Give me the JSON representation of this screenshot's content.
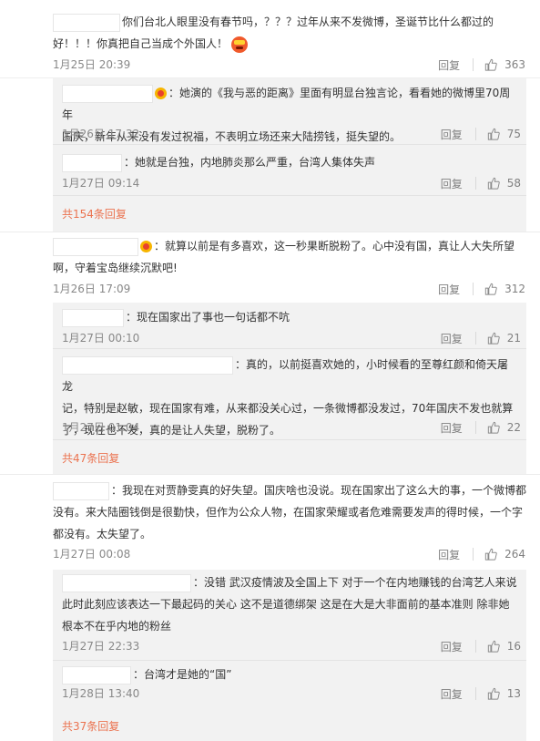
{
  "labels": {
    "reply": "回复"
  },
  "comments": [
    {
      "text_lines": [
        "你们台北人眼里没有春节吗，？？？过年从来不发微博，圣诞节比什么都过的",
        "好！！！你真把自己当成个外国人！"
      ],
      "time": "1月25日 20:39",
      "likes": "363",
      "replies": [],
      "more": ""
    },
    {
      "text_lines": [
        "",
        ""
      ],
      "time": "",
      "likes": "",
      "replies": [
        {
          "text_lines": [
            "：她演的《我与恶的距离》里面有明显台独言论，看看她的微博里70周年",
            "国庆，新年从来没有发过祝福，不表明立场还来大陆捞钱，挺失望的。"
          ],
          "time": "1月26日 17:32",
          "likes": "75"
        },
        {
          "text_lines": [
            "：她就是台独，内地肺炎那么严重，台湾人集体失声"
          ],
          "time": "1月27日 09:14",
          "likes": "58"
        }
      ],
      "more": "共154条回复"
    },
    {
      "text_lines": [
        "：就算以前是有多喜欢，这一秒果断脱粉了。心中没有国，真让人大失所望",
        "啊，守着宝岛继续沉默吧!"
      ],
      "time": "1月26日 17:09",
      "likes": "312",
      "replies": [
        {
          "text_lines": [
            "：现在国家出了事也一句话都不吭"
          ],
          "time": "1月27日 00:10",
          "likes": "21"
        },
        {
          "text_lines": [
            "：真的，以前挺喜欢她的，小时候看的至尊红颜和倚天屠龙",
            "记，特别是赵敏，现在国家有难，从来都没关心过，一条微博都没发过，70年国庆不发也就算",
            "了，现在也不发，真的是让人失望，脱粉了。"
          ],
          "time": "1月27日 01:04",
          "likes": "22"
        }
      ],
      "more": "共47条回复"
    },
    {
      "text_lines": [
        "：我现在对贾静雯真的好失望。国庆啥也没说。现在国家出了这么大的事，一个微博都",
        "没有。来大陆圈钱倒是很勤快，但作为公众人物，在国家荣耀或者危难需要发声的得时候，一个字",
        "都没有。太失望了。"
      ],
      "time": "1月27日 00:08",
      "likes": "264",
      "replies": [
        {
          "text_lines": [
            "：没错 武汉疫情波及全国上下  对于一个在内地赚钱的台湾艺人来说",
            "此时此刻应该表达一下最起码的关心 这不是道德绑架 这是在大是大非面前的基本准则 除非她",
            "根本不在乎内地的粉丝"
          ],
          "time": "1月27日 22:33",
          "likes": "16"
        },
        {
          "text_lines": [
            "：台湾才是她的“国”"
          ],
          "time": "1月28日 13:40",
          "likes": "13"
        }
      ],
      "more": "共37条回复"
    }
  ]
}
